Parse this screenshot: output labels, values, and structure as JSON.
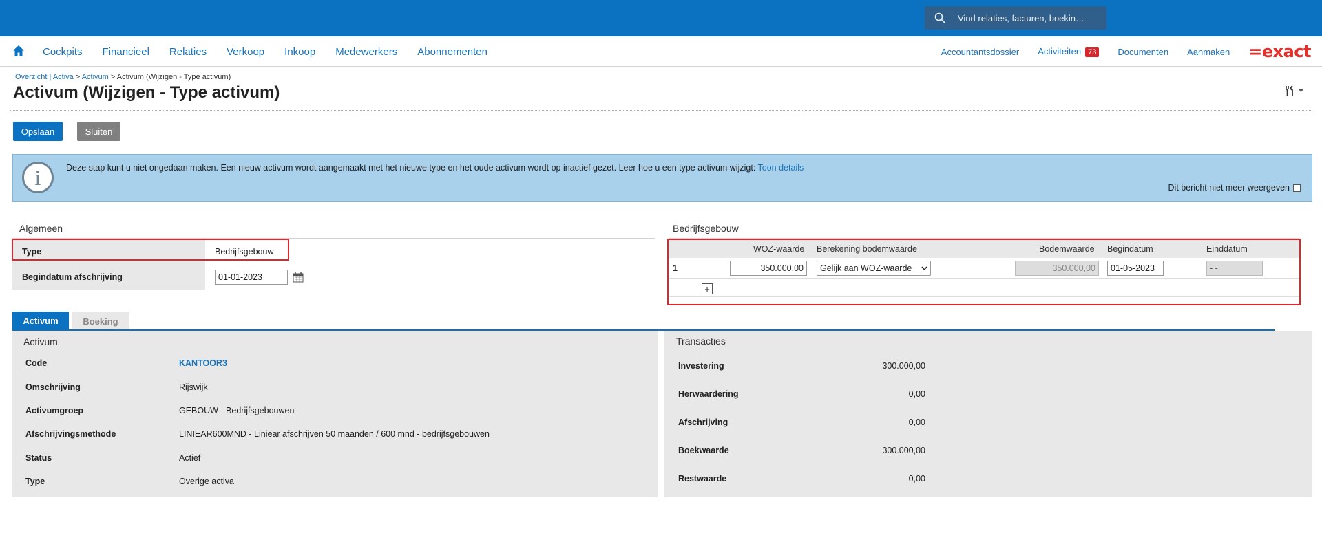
{
  "search": {
    "placeholder": "Vind relaties, facturen, boekin…"
  },
  "nav": {
    "items": [
      "Cockpits",
      "Financieel",
      "Relaties",
      "Verkoop",
      "Inkoop",
      "Medewerkers",
      "Abonnementen"
    ],
    "right": {
      "accountantsdossier": "Accountantsdossier",
      "activiteiten": "Activiteiten",
      "activiteiten_count": "73",
      "documenten": "Documenten",
      "aanmaken": "Aanmaken"
    },
    "logo": "=exact"
  },
  "breadcrumb": {
    "part1": "Overzicht | Activa",
    "sep1": " > ",
    "part2": "Activum",
    "sep2": " > ",
    "current": "Activum (Wijzigen - Type activum)"
  },
  "page_title": "Activum (Wijzigen - Type activum)",
  "toolbar": {
    "save_label": "Opslaan",
    "close_label": "Sluiten"
  },
  "info": {
    "text": "Deze stap kunt u niet ongedaan maken. Een nieuw activum wordt aangemaakt met het nieuwe type en het oude activum wordt op inactief gezet. Leer hoe u een type activum wijzigt: ",
    "link": "Toon details",
    "dismiss": "Dit bericht niet meer weergeven"
  },
  "algemeen": {
    "title": "Algemeen",
    "type_label": "Type",
    "type_value": "Bedrijfsgebouw",
    "begindatum_label": "Begindatum afschrijving",
    "begindatum_value": "01-01-2023"
  },
  "bedrijfsgebouw": {
    "title": "Bedrijfsgebouw",
    "headers": {
      "woz": "WOZ-waarde",
      "berekening": "Berekening bodemwaarde",
      "bodemwaarde": "Bodemwaarde",
      "begindatum": "Begindatum",
      "einddatum": "Einddatum"
    },
    "row": {
      "index": "1",
      "woz": "350.000,00",
      "berekening": "Gelijk aan WOZ-waarde",
      "bodemwaarde": "350.000,00",
      "begindatum": "01-05-2023",
      "einddatum": "- -"
    }
  },
  "tabs": {
    "activum": "Activum",
    "boeking": "Boeking"
  },
  "activum_panel": {
    "title": "Activum",
    "rows": [
      {
        "label": "Code",
        "value": "KANTOOR3"
      },
      {
        "label": "Omschrijving",
        "value": "Rijswijk"
      },
      {
        "label": "Activumgroep",
        "value": "GEBOUW - Bedrijfsgebouwen"
      },
      {
        "label": "Afschrijvingsmethode",
        "value": "LINIEAR600MND - Liniear afschrijven 50 maanden / 600 mnd - bedrijfsgebouwen"
      },
      {
        "label": "Status",
        "value": "Actief"
      },
      {
        "label": "Type",
        "value": "Overige activa"
      }
    ]
  },
  "transacties_panel": {
    "title": "Transacties",
    "rows": [
      {
        "label": "Investering",
        "value": "300.000,00"
      },
      {
        "label": "Herwaardering",
        "value": "0,00"
      },
      {
        "label": "Afschrijving",
        "value": "0,00"
      },
      {
        "label": "Boekwaarde",
        "value": "300.000,00"
      },
      {
        "label": "Restwaarde",
        "value": "0,00"
      }
    ]
  }
}
